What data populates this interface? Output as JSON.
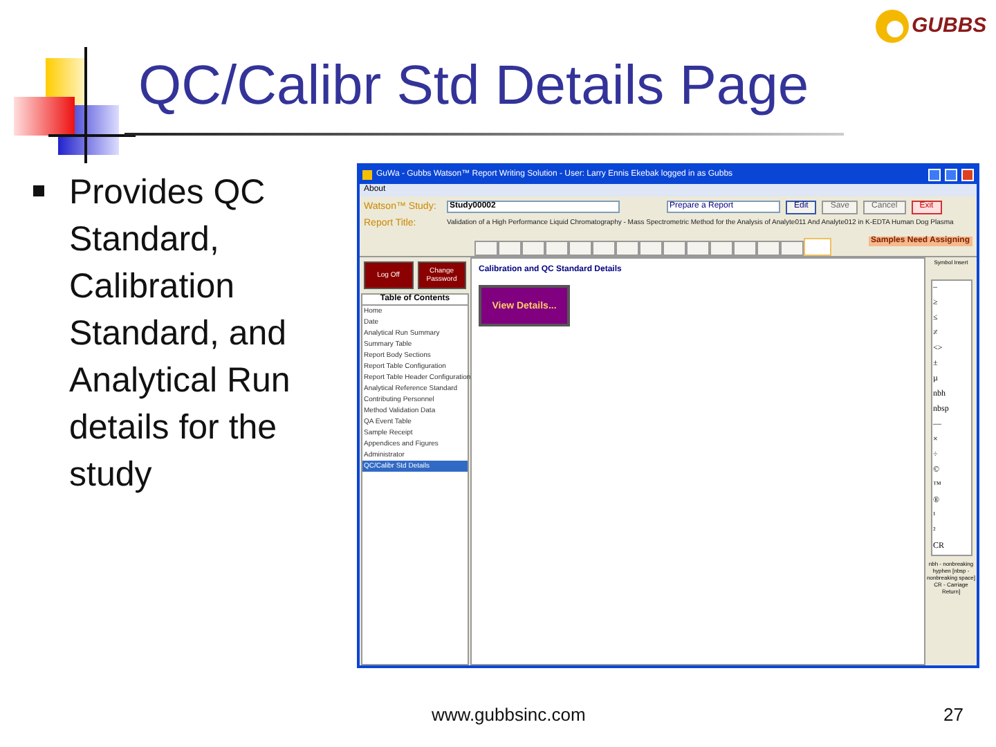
{
  "slide": {
    "title": "QC/Calibr Std Details Page",
    "logo": "GUBBS",
    "footer": "www.gubbsinc.com",
    "page_number": "27"
  },
  "bullets": [
    "Provides QC Standard, Calibration Standard, and Analytical Run details for the study"
  ],
  "app_window": {
    "title": "GuWa - Gubbs Watson™ Report Writing Solution - User: Larry Ennis Ekebak logged in as Gubbs",
    "menu": [
      "About"
    ],
    "study_label": "Watson™ Study:",
    "study_value": "Study00002",
    "report_select": "Prepare a Report",
    "buttons": [
      {
        "label": "Edit",
        "kind": "normal"
      },
      {
        "label": "Save",
        "kind": "disabled"
      },
      {
        "label": "Cancel",
        "kind": "disabled"
      },
      {
        "label": "Exit",
        "kind": "exit"
      }
    ],
    "report_title_label": "Report Title:",
    "report_title_value": "Validation of a High Performance Liquid Chromatography - Mass Spectrometric Method for the Analysis of Analyte011 And Analyte012 in K-EDTA Human Dog Plasma",
    "tabs": [
      {
        "selected": false
      },
      {
        "selected": false
      },
      {
        "selected": false
      },
      {
        "selected": false
      },
      {
        "selected": false
      },
      {
        "selected": false
      },
      {
        "selected": false
      },
      {
        "selected": false
      },
      {
        "selected": false
      },
      {
        "selected": false
      },
      {
        "selected": false
      },
      {
        "selected": false
      },
      {
        "selected": false
      },
      {
        "selected": false
      },
      {
        "selected": true
      }
    ],
    "alert": "Samples Need Assigning",
    "action_buttons": [
      "Log Off",
      "Change Password"
    ],
    "toc_title": "Table of Contents",
    "toc_items": [
      {
        "label": "Home",
        "selected": false
      },
      {
        "label": "Date",
        "selected": false
      },
      {
        "label": "Analytical Run Summary",
        "selected": false
      },
      {
        "label": "Summary Table",
        "selected": false
      },
      {
        "label": "Report Body Sections",
        "selected": false
      },
      {
        "label": "Report Table Configuration",
        "selected": false
      },
      {
        "label": "Report Table Header Configuration",
        "selected": false
      },
      {
        "label": "Analytical Reference Standard",
        "selected": false
      },
      {
        "label": "Contributing Personnel",
        "selected": false
      },
      {
        "label": "Method Validation Data",
        "selected": false
      },
      {
        "label": "QA Event Table",
        "selected": false
      },
      {
        "label": "Sample Receipt",
        "selected": false
      },
      {
        "label": "Appendices and Figures",
        "selected": false
      },
      {
        "label": "Administrator",
        "selected": false
      },
      {
        "label": "QC/Calibr Std Details",
        "selected": true
      }
    ],
    "content_heading": "Calibration and QC Standard Details",
    "view_button": "View Details...",
    "symbol_panel": {
      "label": "Symbol Insert",
      "symbols": [
        "–",
        "≥",
        "≤",
        "≠",
        "<>",
        "±",
        "µ",
        "nbh",
        "nbsp",
        "—",
        "×",
        "÷",
        "©",
        "™",
        "®",
        "¹",
        "²",
        "CR"
      ],
      "note": "nbh - nonbreaking hyphen [nbsp - nonbreaking space] CR - Carriage Return]"
    }
  }
}
